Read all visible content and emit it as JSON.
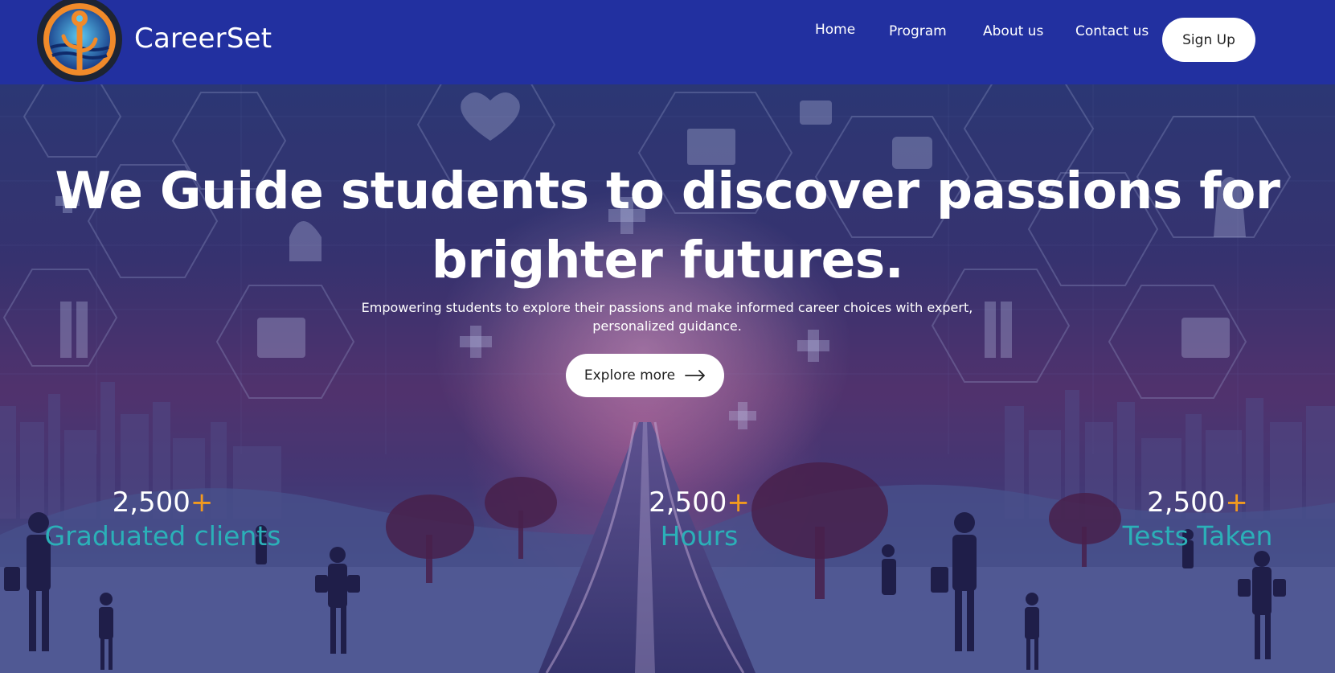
{
  "brand": {
    "name": "CareerSet",
    "logo_icon": "tree-logo-icon"
  },
  "nav": {
    "items": [
      {
        "label": "Home"
      },
      {
        "label": "Program"
      },
      {
        "label": "About us"
      },
      {
        "label": "Contact us"
      }
    ],
    "signup_label": "Sign Up"
  },
  "hero": {
    "headline_line1": "We Guide students to discover passions for",
    "headline_line2": "brighter futures.",
    "subtext_line1": "Empowering students to explore their passions and make informed career choices with expert,",
    "subtext_line2": "personalized guidance.",
    "cta_label": "Explore more",
    "cta_icon": "arrow-right-icon"
  },
  "stats": [
    {
      "number": "2,500",
      "suffix": "+",
      "label": "Graduated clients"
    },
    {
      "number": "2,500",
      "suffix": "+",
      "label": "Hours"
    },
    {
      "number": "2,500",
      "suffix": "+",
      "label": "Tests Taken"
    }
  ],
  "colors": {
    "header_bg": "#2230a0",
    "accent_orange": "#f29a1e",
    "accent_teal": "#2bb0b8"
  }
}
